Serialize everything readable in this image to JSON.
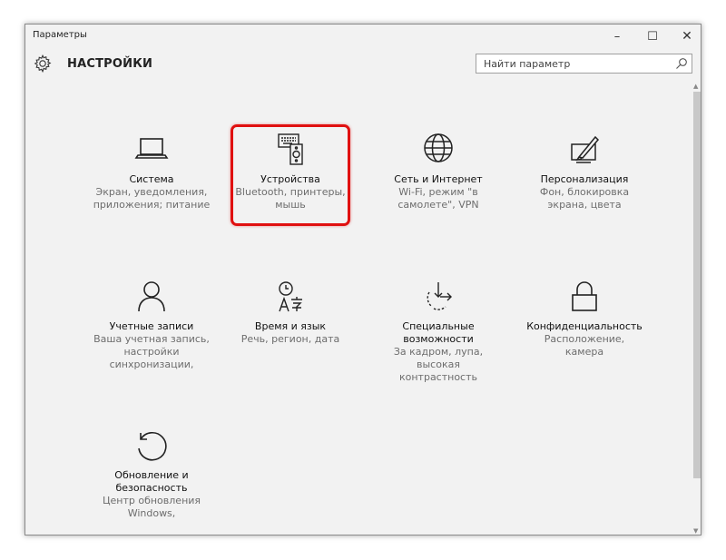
{
  "window": {
    "title": "Параметры",
    "minimize": "–",
    "maximize": "☐",
    "close": "✕"
  },
  "header": {
    "title": "НАСТРОЙКИ",
    "icon": "gear-icon"
  },
  "search": {
    "placeholder": "Найти параметр",
    "icon": "search-icon"
  },
  "tiles": [
    {
      "name": "Система",
      "desc": "Экран, уведомления, приложения; питание",
      "icon": "laptop-icon"
    },
    {
      "name": "Устройства",
      "desc": "Bluetooth, принтеры, мышь",
      "icon": "devices-icon"
    },
    {
      "name": "Сеть и Интернет",
      "desc": "Wi-Fi, режим \"в самолете\", VPN",
      "icon": "globe-icon"
    },
    {
      "name": "Персонализация",
      "desc": "Фон, блокировка экрана, цвета",
      "icon": "personalization-icon"
    },
    {
      "name": "Учетные записи",
      "desc": "Ваша учетная запись, настройки синхронизации,",
      "icon": "person-icon"
    },
    {
      "name": "Время и язык",
      "desc": "Речь, регион, дата",
      "icon": "time-language-icon"
    },
    {
      "name": "Специальные возможности",
      "desc": "За кадром, лупа, высокая контрастность",
      "icon": "accessibility-icon"
    },
    {
      "name": "Конфиденциальность",
      "desc": "Расположение, камера",
      "icon": "lock-icon"
    },
    {
      "name": "Обновление и безопасность",
      "desc": "Центр обновления Windows,",
      "icon": "update-icon"
    }
  ],
  "colors": {
    "highlight": "#e01010",
    "background": "#f2f2f2"
  }
}
